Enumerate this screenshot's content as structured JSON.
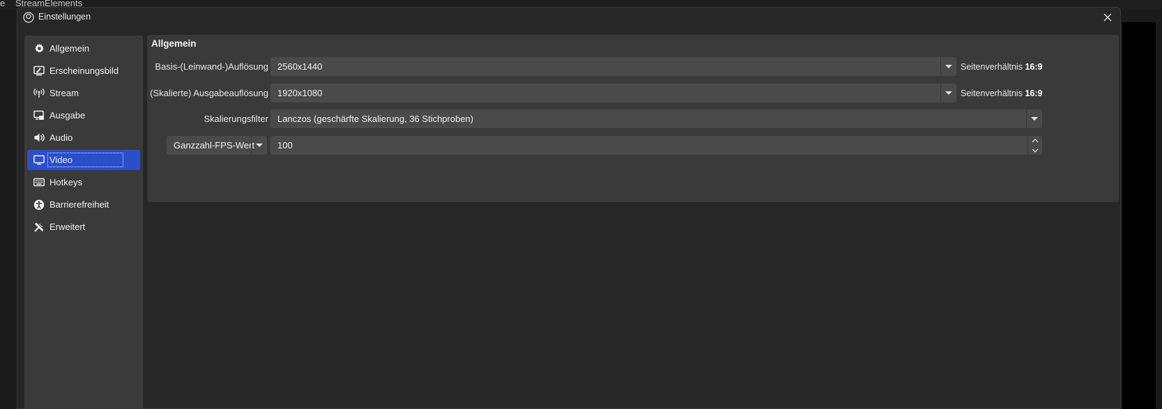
{
  "background": {
    "menu": [
      "e",
      "StreamElements"
    ]
  },
  "dialog": {
    "title": "Einstellungen",
    "close_icon": "close-icon"
  },
  "sidebar": {
    "items": [
      {
        "label": "Allgemein",
        "icon": "gear-icon",
        "active": false
      },
      {
        "label": "Erscheinungsbild",
        "icon": "appearance-icon",
        "active": false
      },
      {
        "label": "Stream",
        "icon": "broadcast-icon",
        "active": false
      },
      {
        "label": "Ausgabe",
        "icon": "output-icon",
        "active": false
      },
      {
        "label": "Audio",
        "icon": "speaker-icon",
        "active": false
      },
      {
        "label": "Video",
        "icon": "monitor-icon",
        "active": true
      },
      {
        "label": "Hotkeys",
        "icon": "keyboard-icon",
        "active": false
      },
      {
        "label": "Barrierefreiheit",
        "icon": "accessibility-icon",
        "active": false
      },
      {
        "label": "Erweitert",
        "icon": "tools-icon",
        "active": false
      }
    ]
  },
  "video": {
    "group_title": "Allgemein",
    "base_resolution": {
      "label": "Basis-(Leinwand-)Auflösung",
      "value": "2560x1440",
      "aspect_label": "Seitenverhältnis",
      "aspect_value": "16:9"
    },
    "output_resolution": {
      "label": "(Skalierte) Ausgabeauflösung",
      "value": "1920x1080",
      "aspect_label": "Seitenverhältnis",
      "aspect_value": "16:9"
    },
    "scale_filter": {
      "label": "Skalierungsfilter",
      "value": "Lanczos (geschärfte Skalierung, 36 Stichproben)"
    },
    "fps": {
      "type_value": "Ganzzahl-FPS-Wert",
      "value": "100"
    }
  },
  "colors": {
    "accent": "#2b4ec9",
    "panel": "#3a3a3a",
    "field": "#4a4a4a",
    "window": "#272727"
  }
}
